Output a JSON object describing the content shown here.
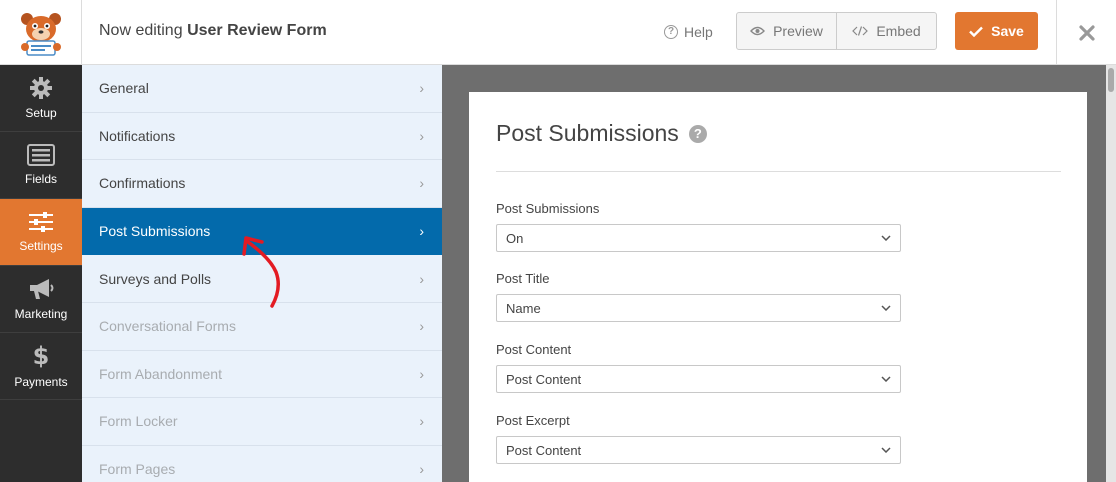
{
  "header": {
    "title_prefix": "Now editing",
    "form_name": "User Review Form",
    "help_label": "Help",
    "preview_label": "Preview",
    "embed_label": "Embed",
    "save_label": "Save",
    "accent_color": "#e27730"
  },
  "sidebar": {
    "items": [
      {
        "label": "Setup",
        "icon": "gear-icon",
        "active": false
      },
      {
        "label": "Fields",
        "icon": "fields-icon",
        "active": false
      },
      {
        "label": "Settings",
        "icon": "sliders-icon",
        "active": true
      },
      {
        "label": "Marketing",
        "icon": "megaphone-icon",
        "active": false
      },
      {
        "label": "Payments",
        "icon": "dollar-icon",
        "active": false
      }
    ]
  },
  "settings_menu": {
    "items": [
      {
        "label": "General",
        "state": "normal"
      },
      {
        "label": "Notifications",
        "state": "normal"
      },
      {
        "label": "Confirmations",
        "state": "normal"
      },
      {
        "label": "Post Submissions",
        "state": "active"
      },
      {
        "label": "Surveys and Polls",
        "state": "normal"
      },
      {
        "label": "Conversational Forms",
        "state": "disabled"
      },
      {
        "label": "Form Abandonment",
        "state": "disabled"
      },
      {
        "label": "Form Locker",
        "state": "disabled"
      },
      {
        "label": "Form Pages",
        "state": "disabled"
      }
    ],
    "active_color": "#036aab"
  },
  "panel": {
    "title": "Post Submissions",
    "fields": [
      {
        "label": "Post Submissions",
        "value": "On"
      },
      {
        "label": "Post Title",
        "value": "Name"
      },
      {
        "label": "Post Content",
        "value": "Post Content"
      },
      {
        "label": "Post Excerpt",
        "value": "Post Content"
      }
    ]
  }
}
